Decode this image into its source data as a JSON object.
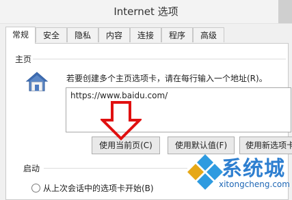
{
  "window": {
    "title": "Internet 选项"
  },
  "tabs": [
    {
      "label": "常规",
      "active": true
    },
    {
      "label": "安全",
      "active": false
    },
    {
      "label": "隐私",
      "active": false
    },
    {
      "label": "内容",
      "active": false
    },
    {
      "label": "连接",
      "active": false
    },
    {
      "label": "程序",
      "active": false
    },
    {
      "label": "高级",
      "active": false
    }
  ],
  "home": {
    "group_label": "主页",
    "icon": "house-icon",
    "description": "若要创建多个主页选项卡，请在每行输入一个地址(R)。",
    "url_value": "https://www.baidu.com/"
  },
  "buttons": {
    "use_current": "使用当前页(C)",
    "use_default": "使用默认值(F)",
    "use_new_tab": "使用新选项卡"
  },
  "startup": {
    "group_label": "启动",
    "option_1": "从上次会话中的选项卡开始(B)"
  },
  "watermark": {
    "brand": "系统城",
    "domain": "xitongcheng.com"
  },
  "colors": {
    "arrow": "#e01010",
    "watermark_blue": "#2e7fd0"
  }
}
